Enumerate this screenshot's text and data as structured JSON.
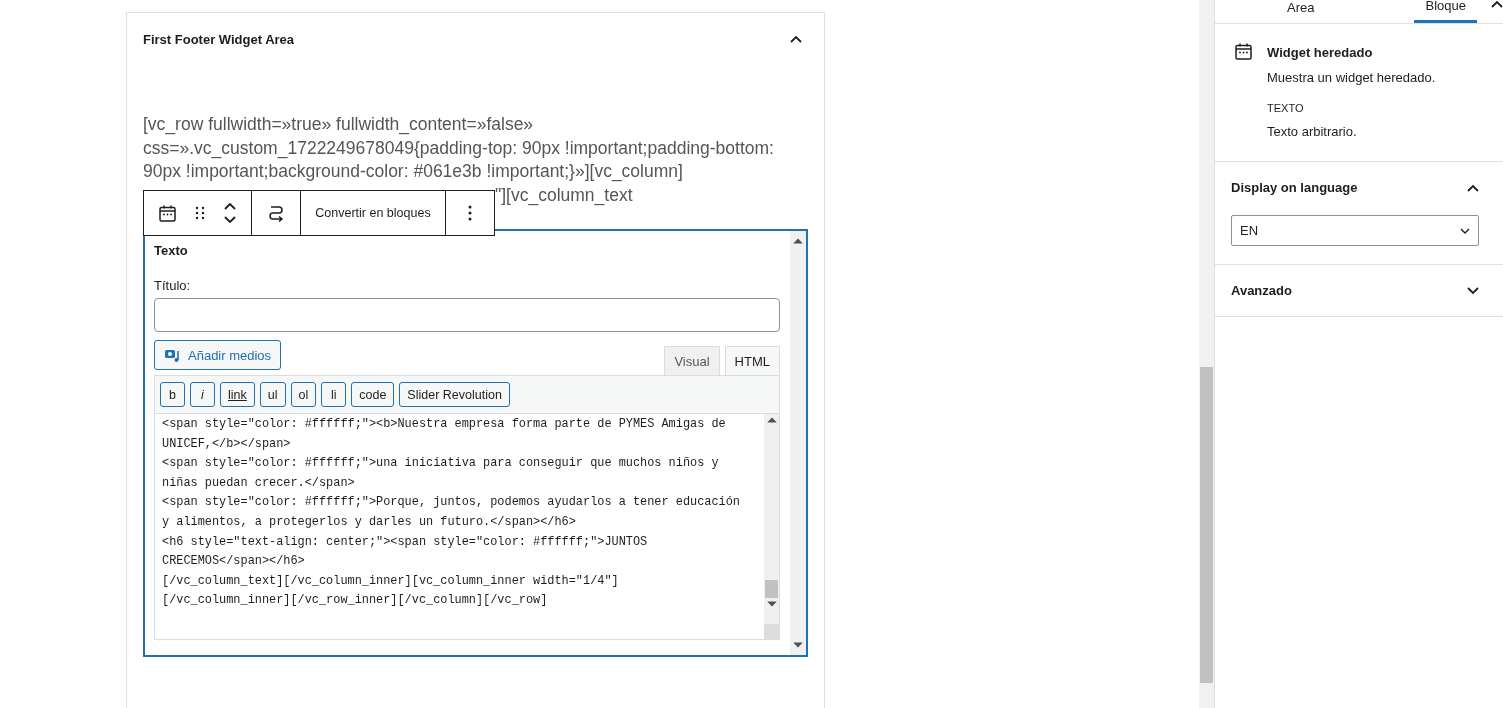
{
  "widget_area": {
    "title": "First Footer Widget Area",
    "expanded": true,
    "legacy_text": [
      "[vc_row fullwidth=»true» fullwidth_content=»false»",
      "css=».vc_custom_1722249678049{padding-top: 90px !important;padding-bottom:",
      "90px !important;background-color: #061e3b !important;}»][vc_column]",
      "\"][vc_column_text"
    ],
    "toolbar": {
      "convert_button": "Convertir en bloques"
    },
    "widget": {
      "title": "Texto",
      "field_label": "Título:",
      "add_media": "Añadir medios",
      "editor_tabs": [
        {
          "label": "Visual",
          "selected": false
        },
        {
          "label": "HTML",
          "selected": true
        }
      ],
      "quicktags": [
        {
          "label": "b",
          "kind": "plain"
        },
        {
          "label": "i",
          "kind": "italic"
        },
        {
          "label": "link",
          "kind": "underline"
        },
        {
          "label": "ul",
          "kind": "plain"
        },
        {
          "label": "ol",
          "kind": "plain"
        },
        {
          "label": "li",
          "kind": "plain"
        },
        {
          "label": "code",
          "kind": "plain"
        },
        {
          "label": "Slider Revolution",
          "kind": "plain"
        }
      ],
      "code_lines": [
        "<span style=\"color: #ffffff;\"><b>Nuestra empresa forma parte de PYMES Amigas de",
        "UNICEF,</b></span>",
        "<span style=\"color: #ffffff;\">una iniciativa para conseguir que muchos niños y",
        "niñas puedan crecer.</span>",
        "<span style=\"color: #ffffff;\">Porque, juntos, podemos ayudarlos a tener educación",
        "y alimentos, a protegerlos y darles un futuro.</span></h6>",
        "<h6 style=\"text-align: center;\"><span style=\"color: #ffffff;\">JUNTOS",
        "CRECEMOS</span></h6>",
        "[/vc_column_text][/vc_column_inner][vc_column_inner width=\"1/4\"]",
        "[/vc_column_inner][/vc_row_inner][/vc_column][/vc_row]"
      ]
    }
  },
  "sidebar": {
    "tabs": [
      {
        "label": "Area",
        "selected": false
      },
      {
        "label": "Bloque",
        "selected": true
      }
    ],
    "block": {
      "title": "Widget heredado",
      "description": "Muestra un widget heredado.",
      "widget_type": "TEXTO",
      "widget_description": "Texto arbitrario."
    },
    "panels": [
      {
        "title": "Display on language",
        "expanded": true,
        "select_value": "EN"
      },
      {
        "title": "Avanzado",
        "expanded": false
      }
    ]
  }
}
